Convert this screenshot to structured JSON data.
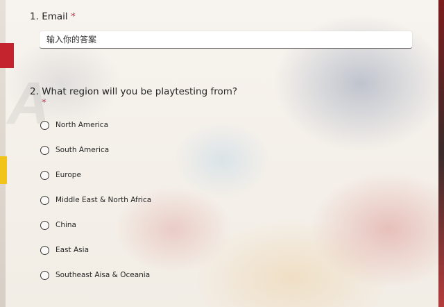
{
  "questions": [
    {
      "number": "1.",
      "text": "Email",
      "required_mark": "*",
      "input": {
        "value": "",
        "placeholder": "输入你的答案"
      }
    },
    {
      "number": "2.",
      "text": "What region will you be playtesting from?",
      "required_mark": "*",
      "options": [
        "North America",
        "South America",
        "Europe",
        "Middle East & North Africa",
        "China",
        "East Asia",
        "Southeast Aisa & Oceania"
      ]
    }
  ],
  "colors": {
    "required": "#c4314b",
    "text": "#242424",
    "input_border": "#605e5c"
  }
}
